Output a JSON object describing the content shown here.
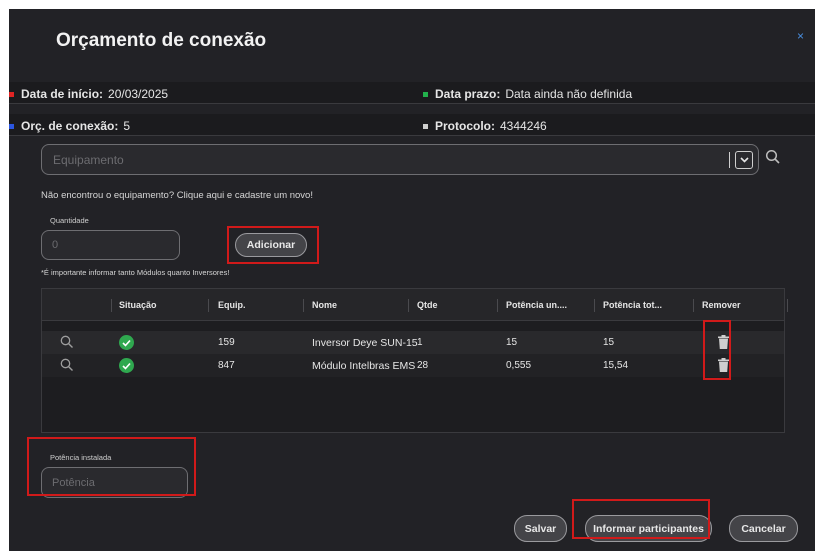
{
  "dialog": {
    "title": "Orçamento de conexão",
    "close_icon": "×"
  },
  "info": {
    "start_label": "Data de início:",
    "start_value": "20/03/2025",
    "start_color": "#e02424",
    "deadline_label": "Data prazo:",
    "deadline_value": "Data ainda não definida",
    "deadline_color": "#22b14c",
    "orc_label": "Orç. de conexão:",
    "orc_value": "5",
    "orc_color": "#2b56e0",
    "protocol_label": "Protocolo:",
    "protocol_value": "4344246",
    "protocol_color": "#cfcfcf"
  },
  "equipment_select": {
    "placeholder": "Equipamento",
    "dropdown_icon": "chevron-down-icon",
    "search_icon": "search-icon"
  },
  "hint_text": "Não encontrou o equipamento? Clique aqui e cadastre um novo!",
  "quantity": {
    "label": "Quantidade",
    "placeholder": "0"
  },
  "add_button": "Adicionar",
  "note": "*É importante informar tanto Módulos quanto Inversores!",
  "table": {
    "columns": [
      "Situação",
      "Equip.",
      "Nome",
      "Qtde",
      "Potência un....",
      "Potência tot...",
      "Remover"
    ],
    "rows": [
      {
        "equip": "159",
        "nome": "Inversor Deye SUN-15",
        "qtde": "1",
        "pot_un": "15",
        "pot_tot": "15"
      },
      {
        "equip": "847",
        "nome": "Módulo Intelbras EMS",
        "qtde": "28",
        "pot_un": "0,555",
        "pot_tot": "15,54"
      }
    ]
  },
  "power": {
    "label": "Potência instalada",
    "placeholder": "Potência"
  },
  "footer": {
    "save": "Salvar",
    "inform": "Informar participantes",
    "cancel": "Cancelar"
  },
  "colors": {
    "highlight_red": "#d11a1a",
    "status_ok": "#2fa84f"
  }
}
